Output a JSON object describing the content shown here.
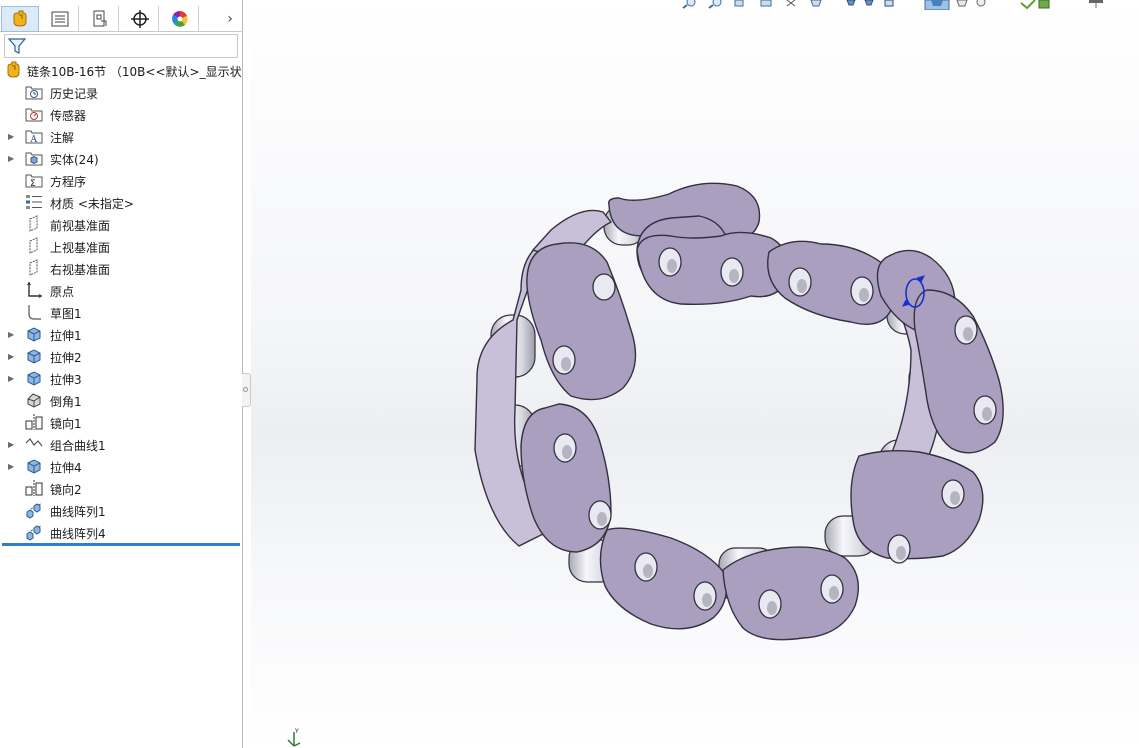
{
  "feature_manager": {
    "tabs": [
      {
        "name": "featuremanager-tab",
        "icon": "featuremanager-icon"
      },
      {
        "name": "propertymanager-tab",
        "icon": "property-list-icon"
      },
      {
        "name": "configurationmanager-tab",
        "icon": "configuration-icon"
      },
      {
        "name": "dimxpertmanager-tab",
        "icon": "crosshair-icon"
      },
      {
        "name": "displaymanager-tab",
        "icon": "color-wheel-icon"
      }
    ],
    "more_tabs_glyph": "›",
    "root_label": "链条10B-16节 （10B<<默认>_显示状态",
    "items": [
      {
        "label": "历史记录",
        "icon": "history-folder-icon"
      },
      {
        "label": "传感器",
        "icon": "sensors-folder-icon"
      },
      {
        "label": "注解",
        "icon": "annotations-folder-icon"
      },
      {
        "label": "实体(24)",
        "icon": "solid-bodies-folder-icon"
      },
      {
        "label": "方程序",
        "icon": "equations-folder-icon"
      },
      {
        "label": "材质 <未指定>",
        "icon": "material-icon"
      },
      {
        "label": "前视基准面",
        "icon": "plane-icon"
      },
      {
        "label": "上视基准面",
        "icon": "plane-icon"
      },
      {
        "label": "右视基准面",
        "icon": "plane-icon"
      },
      {
        "label": "原点",
        "icon": "origin-icon"
      },
      {
        "label": "草图1",
        "icon": "sketch-icon"
      },
      {
        "label": "拉伸1",
        "icon": "extrude-icon"
      },
      {
        "label": "拉伸2",
        "icon": "extrude-icon"
      },
      {
        "label": "拉伸3",
        "icon": "extrude-icon"
      },
      {
        "label": "倒角1",
        "icon": "chamfer-icon"
      },
      {
        "label": "镜向1",
        "icon": "mirror-icon"
      },
      {
        "label": "组合曲线1",
        "icon": "composite-curve-icon"
      },
      {
        "label": "拉伸4",
        "icon": "extrude-icon"
      },
      {
        "label": "镜向2",
        "icon": "mirror-icon"
      },
      {
        "label": "曲线阵列1",
        "icon": "curve-pattern-icon"
      },
      {
        "label": "曲线阵列4",
        "icon": "curve-pattern-icon"
      }
    ]
  },
  "viewport": {
    "model": "roller-chain-model",
    "triad_label": "Y",
    "colors": {
      "link_plate": "#ab9fc0",
      "link_plate_edge": "#34303f",
      "roller": "#e6e6ee",
      "background": "#eceef2"
    }
  }
}
